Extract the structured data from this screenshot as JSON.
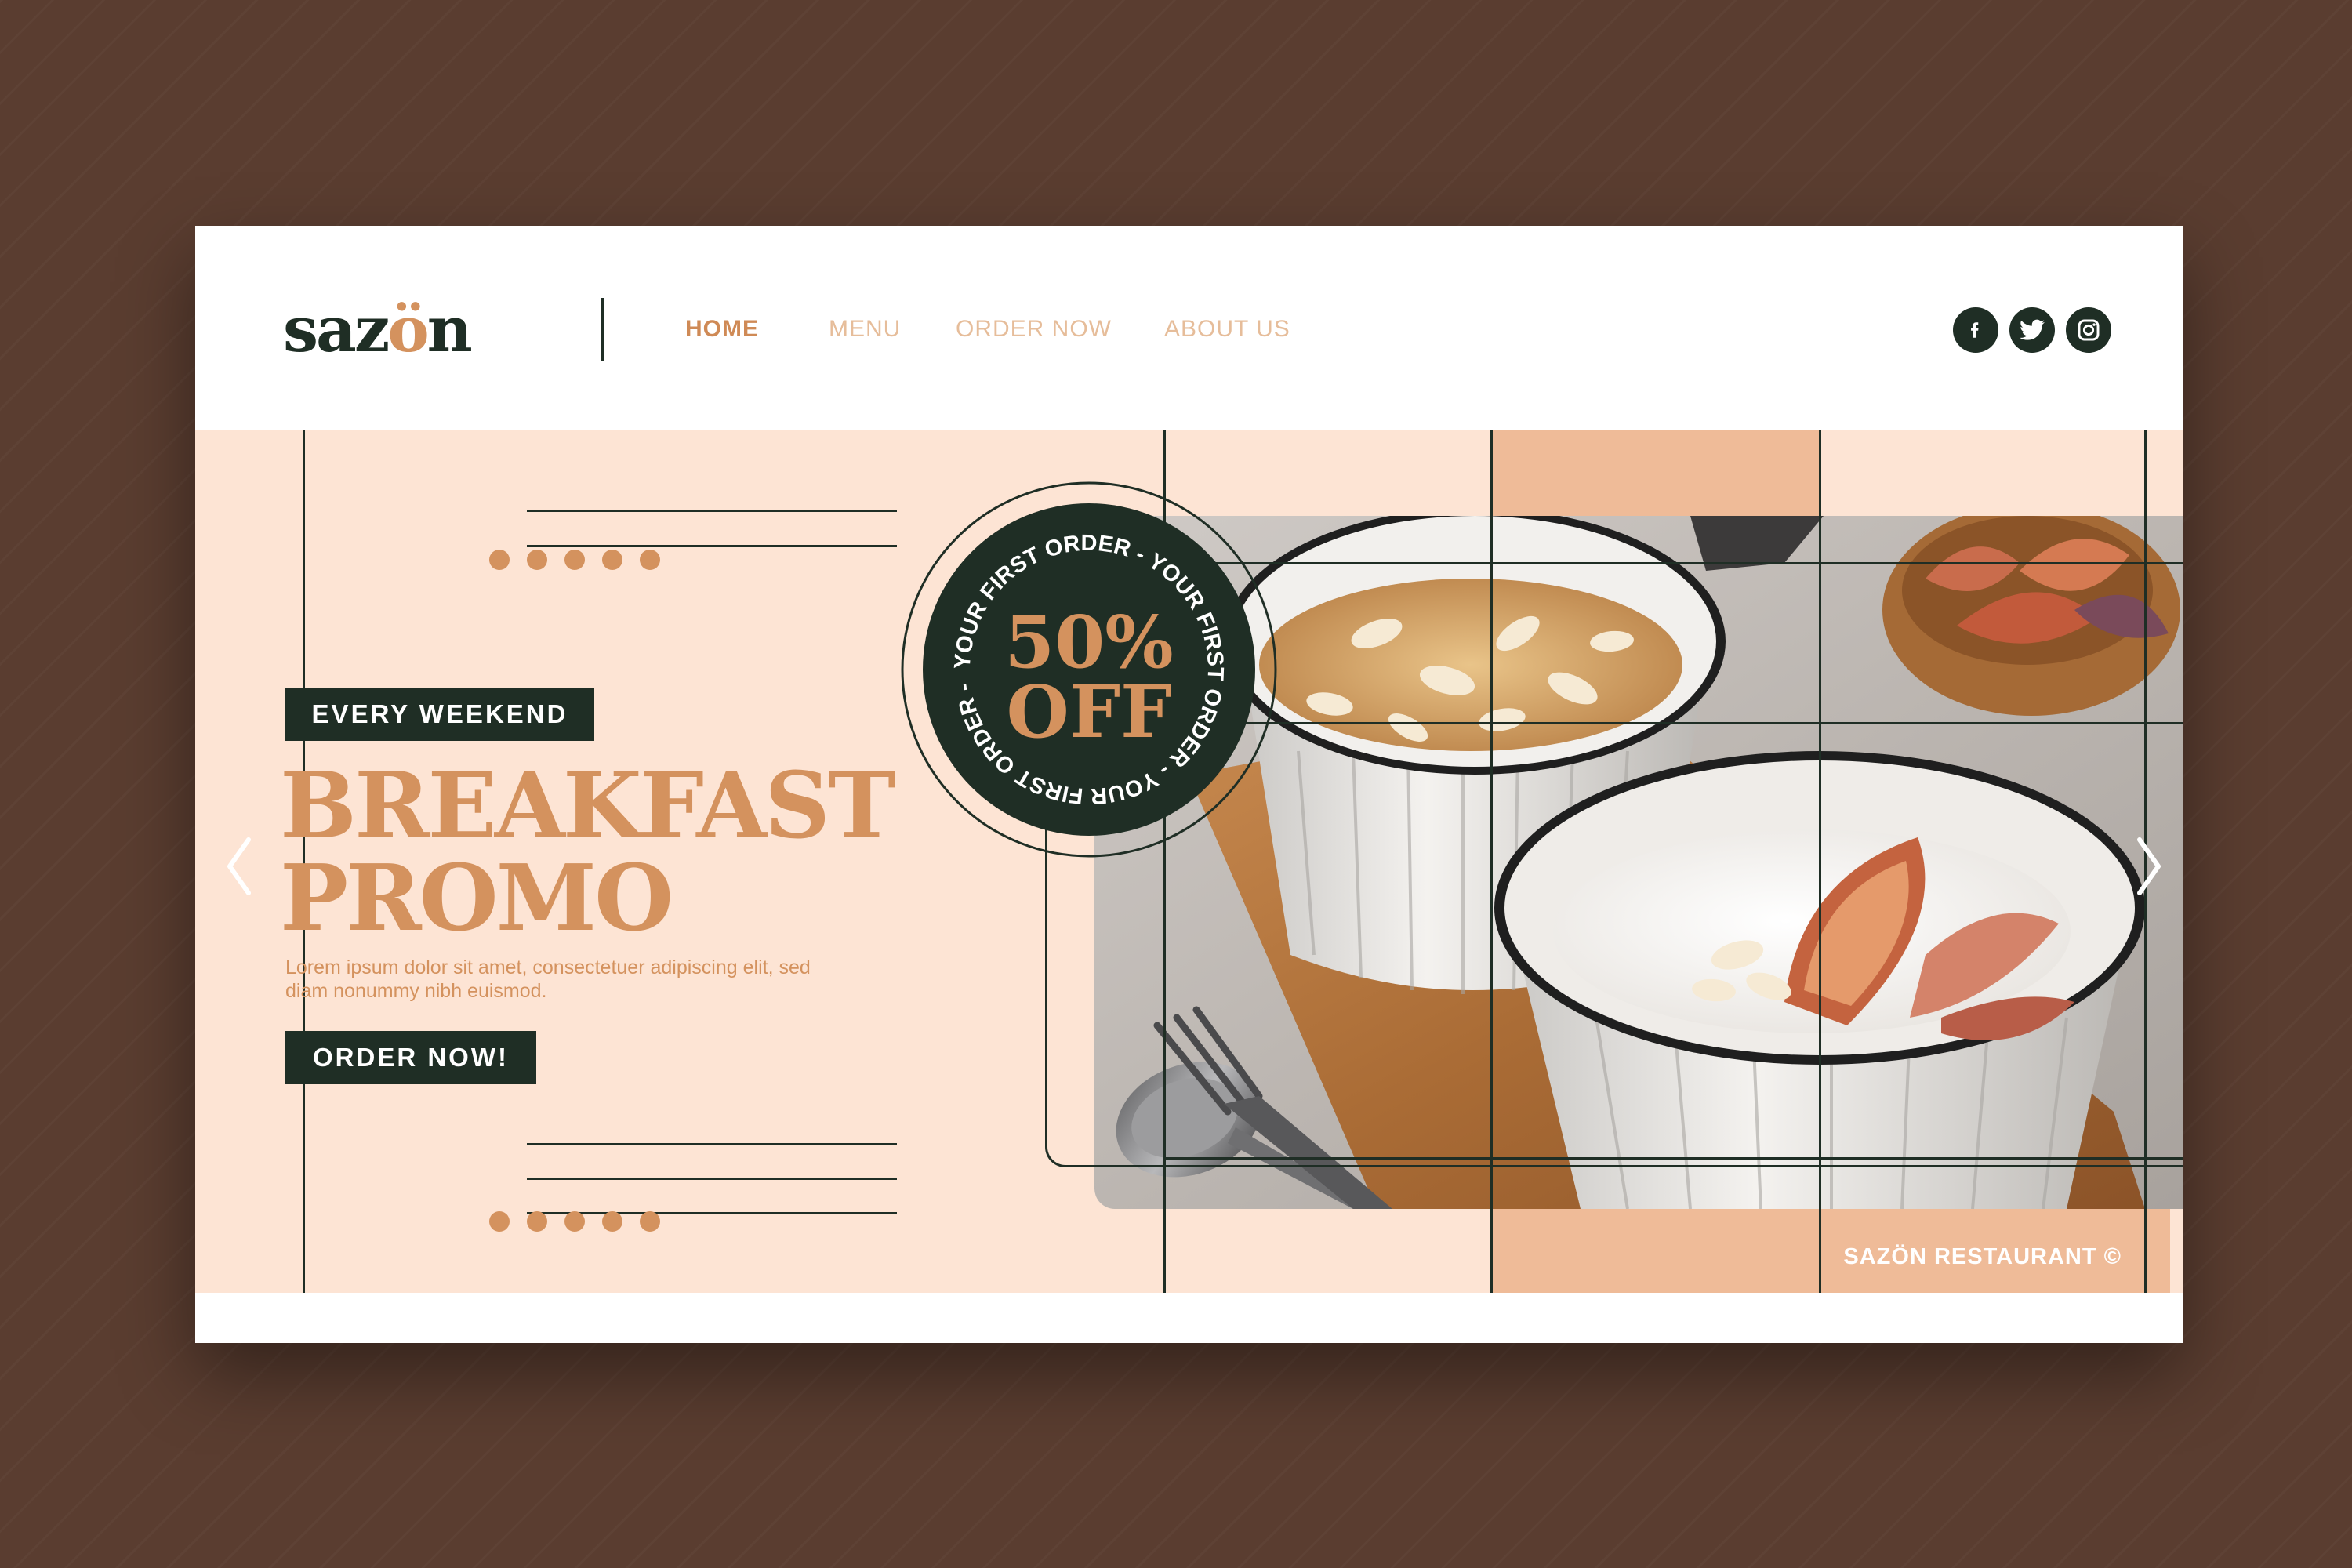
{
  "brand": {
    "logo_start": "saz",
    "logo_accent": "ö",
    "logo_end": "n",
    "dark_color": "#1f2e25",
    "accent_color": "#d4925e",
    "peach_color": "#fde4d4"
  },
  "nav": {
    "items": [
      {
        "label": "HOME",
        "active": true
      },
      {
        "label": "MENU",
        "active": false
      },
      {
        "label": "ORDER NOW",
        "active": false
      },
      {
        "label": "ABOUT US",
        "active": false
      }
    ]
  },
  "social": [
    "facebook-icon",
    "twitter-icon",
    "instagram-icon"
  ],
  "hero": {
    "tag": "EVERY WEEKEND",
    "title_line1": "BREAKFAST",
    "title_line2": "PROMO",
    "body": "Lorem ipsum dolor sit amet, consectetuer adipiscing elit, sed diam nonummy nibh euismod.",
    "cta": "ORDER NOW!",
    "footer": "SAZÖN RESTAURANT ©"
  },
  "badge": {
    "ring_text": "YOUR FIRST ORDER - YOUR FIRST ORDER - YOUR FIRST ORDER -",
    "discount": "50%",
    "discount_label": "OFF"
  },
  "carousel": {
    "prev_icon": "chevron-left-icon",
    "next_icon": "chevron-right-icon"
  }
}
